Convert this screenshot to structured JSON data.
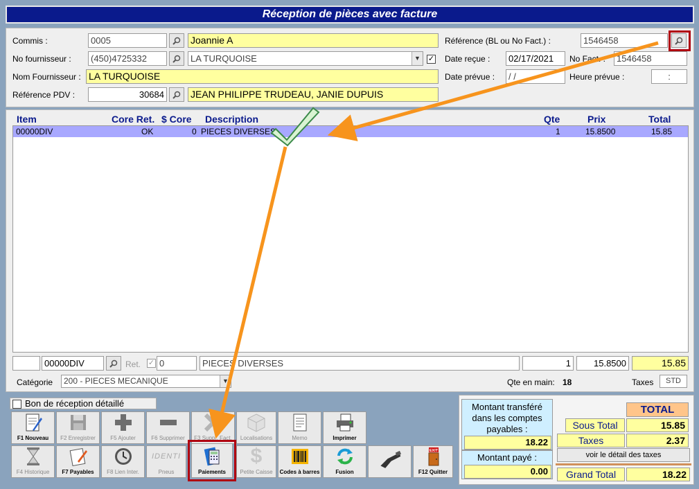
{
  "window": {
    "title": "Réception de pièces avec facture"
  },
  "header": {
    "commis_label": "Commis :",
    "commis_code": "0005",
    "commis_name": "Joannie A",
    "no_fournisseur_label": "No fournisseur :",
    "no_fournisseur": "(450)4725332",
    "fournisseur_select": "LA TURQUOISE",
    "nom_fournisseur_label": "Nom Fournisseur :",
    "nom_fournisseur": "LA TURQUOISE",
    "reference_pdv_label": "Référence PDV :",
    "reference_pdv": "30684",
    "reference_pdv_name": "JEAN PHILIPPE TRUDEAU, JANIE DUPUIS",
    "reference_bl_label": "Référence (BL ou No Fact.) :",
    "reference_bl": "1546458",
    "date_recue_label": "Date reçue :",
    "date_recue": "02/17/2021",
    "no_fact_label": "No Fact. :",
    "no_fact": "1546458",
    "date_prevue_label": "Date prévue :",
    "date_prevue": "/ /",
    "heure_prevue_label": "Heure prévue :",
    "heure_prevue": ":"
  },
  "grid": {
    "columns": {
      "item": "Item",
      "core_ret": "Core Ret.",
      "dollar_core": "$ Core",
      "description": "Description",
      "qte": "Qte",
      "prix": "Prix",
      "total": "Total"
    },
    "rows": [
      {
        "item": "00000DIV",
        "core_ret": "OK",
        "dollar_core": "0",
        "description": "PIECES DIVERSES",
        "qte": "1",
        "prix": "15.8500",
        "total": "15.85"
      }
    ]
  },
  "edit_row": {
    "item": "00000DIV",
    "ret_label": "Ret.",
    "core": "0",
    "description": "PIECES DIVERSES",
    "qte": "1",
    "prix": "15.8500",
    "total": "15.85",
    "categorie_label": "Catégorie",
    "categorie": "200 - PIECES MECANIQUE",
    "qte_en_main_label": "Qte en main:",
    "qte_en_main": "18",
    "taxes_label": "Taxes",
    "taxes_code": "STD"
  },
  "options": {
    "bon_reception_label": "Bon de réception détaillé"
  },
  "toolbar": {
    "row1": [
      {
        "label": "F1 Nouveau",
        "icon": "new-doc-icon"
      },
      {
        "label": "F2 Enregistrer",
        "icon": "floppy-icon"
      },
      {
        "label": "F5 Ajouter",
        "icon": "plus-icon"
      },
      {
        "label": "F6 Supprimer",
        "icon": "minus-icon"
      },
      {
        "label": "F3 Suppr. Fact.",
        "icon": "delete-invoice-icon"
      },
      {
        "label": "Localisations",
        "icon": "box-icon"
      },
      {
        "label": "Memo",
        "icon": "memo-icon"
      },
      {
        "label": "Imprimer",
        "icon": "printer-icon"
      }
    ],
    "row2": [
      {
        "label": "F4 Historique",
        "icon": "hourglass-icon"
      },
      {
        "label": "F7 Payables",
        "icon": "payables-icon"
      },
      {
        "label": "F8 Lien Inter.",
        "icon": "clock-icon"
      },
      {
        "label": "Pneus",
        "icon": "identi-logo-icon",
        "logo_text": "IDENTI"
      },
      {
        "label": "Paiements",
        "icon": "calculator-icon"
      },
      {
        "label": "Petite Caisse",
        "icon": "dollar-icon"
      },
      {
        "label": "Codes à barres",
        "icon": "barcode-icon"
      },
      {
        "label": "Fusion",
        "icon": "refresh-icon"
      },
      {
        "label": "",
        "icon": "scanner-icon"
      },
      {
        "label": "F12 Quitter",
        "icon": "exit-door-icon",
        "logo_text": "EXIT"
      }
    ]
  },
  "payables": {
    "transfer_label": "Montant transféré dans les comptes payables :",
    "transfer_value": "18.22",
    "paid_label": "Montant payé :",
    "paid_value": "0.00"
  },
  "totals": {
    "total_header": "TOTAL",
    "sous_total_label": "Sous Total",
    "sous_total": "15.85",
    "taxes_label": "Taxes",
    "taxes": "2.37",
    "detail_button": "voir le détail des taxes",
    "grand_total_label": "Grand Total",
    "grand_total": "18.22"
  },
  "colors": {
    "title_bar": "#0a1a8c",
    "yellow_field": "#ffff9f",
    "selected_row": "#a8a8ff",
    "arrow": "#f7941d",
    "highlight": "#b00010"
  }
}
